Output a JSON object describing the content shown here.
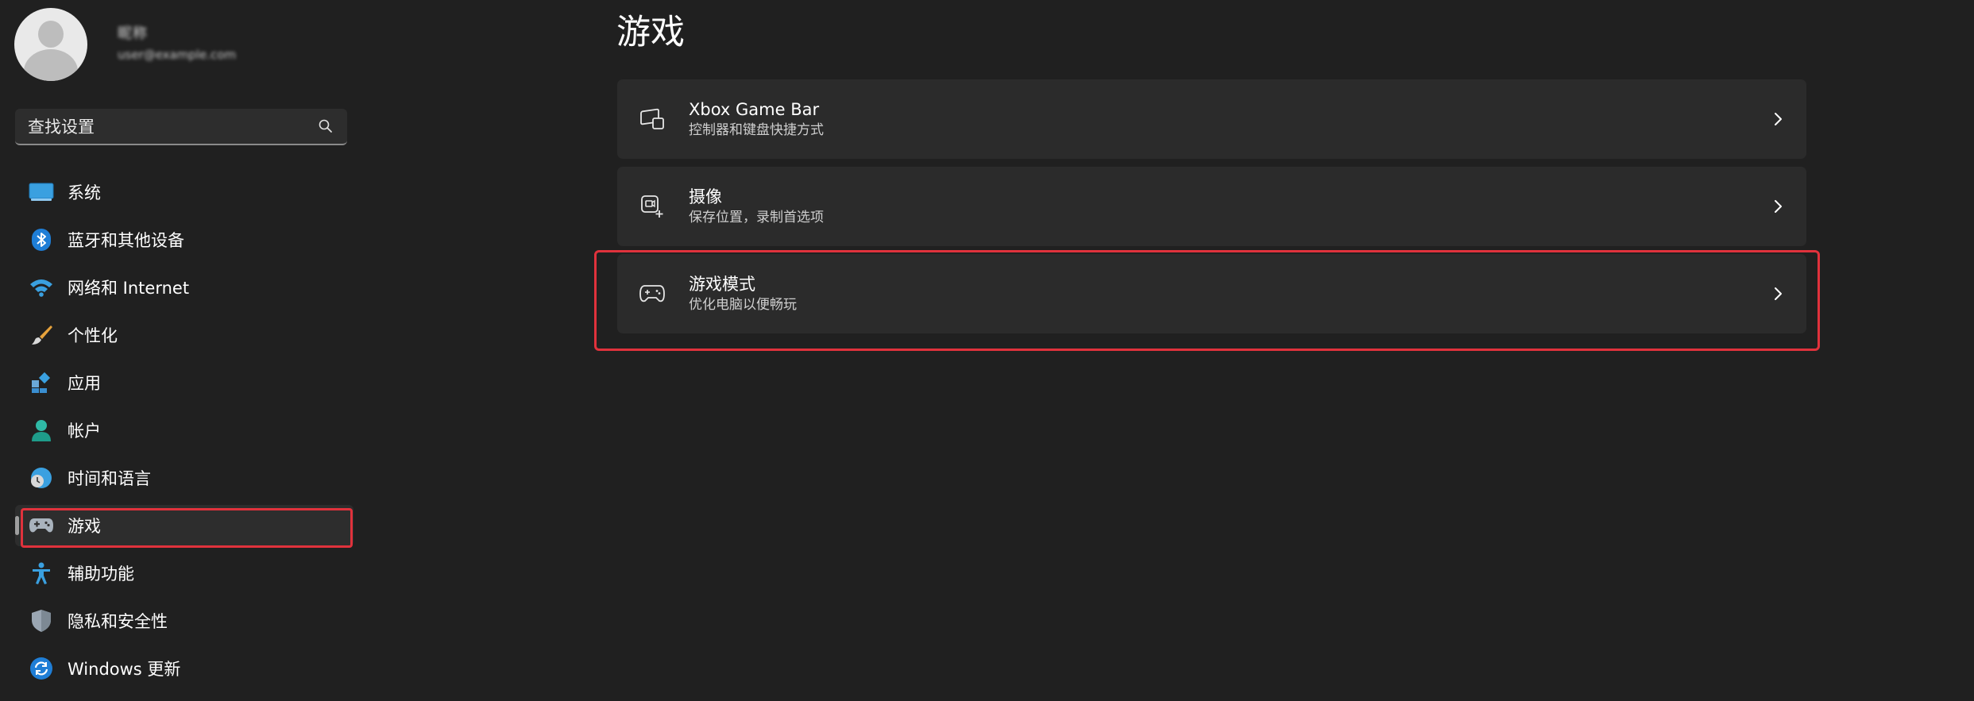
{
  "sidebar": {
    "profile": {
      "name": "昵称",
      "email": "user@example.com"
    },
    "search": {
      "placeholder": "查找设置",
      "icon": "search-icon"
    },
    "items": [
      {
        "label": "系统",
        "icon": "system-display-icon",
        "selected": false
      },
      {
        "label": "蓝牙和其他设备",
        "icon": "bluetooth-icon",
        "selected": false
      },
      {
        "label": "网络和 Internet",
        "icon": "wifi-icon",
        "selected": false
      },
      {
        "label": "个性化",
        "icon": "brush-icon",
        "selected": false
      },
      {
        "label": "应用",
        "icon": "apps-icon",
        "selected": false
      },
      {
        "label": "帐户",
        "icon": "account-icon",
        "selected": false
      },
      {
        "label": "时间和语言",
        "icon": "time-language-icon",
        "selected": false
      },
      {
        "label": "游戏",
        "icon": "gamepad-icon",
        "selected": true
      },
      {
        "label": "辅助功能",
        "icon": "accessibility-icon",
        "selected": false
      },
      {
        "label": "隐私和安全性",
        "icon": "shield-icon",
        "selected": false
      },
      {
        "label": "Windows 更新",
        "icon": "windows-update-icon",
        "selected": false
      }
    ]
  },
  "main": {
    "title": "游戏",
    "cards": [
      {
        "title": "Xbox Game Bar",
        "subtitle": "控制器和键盘快捷方式",
        "icon": "game-bar-icon"
      },
      {
        "title": "摄像",
        "subtitle": "保存位置，录制首选项",
        "icon": "capture-icon"
      },
      {
        "title": "游戏模式",
        "subtitle": "优化电脑以便畅玩",
        "icon": "game-mode-icon"
      }
    ]
  },
  "colors": {
    "background": "#202020",
    "card": "#2b2b2b",
    "highlight": "#e0323c",
    "accent_blue": "#2a9bdc"
  }
}
